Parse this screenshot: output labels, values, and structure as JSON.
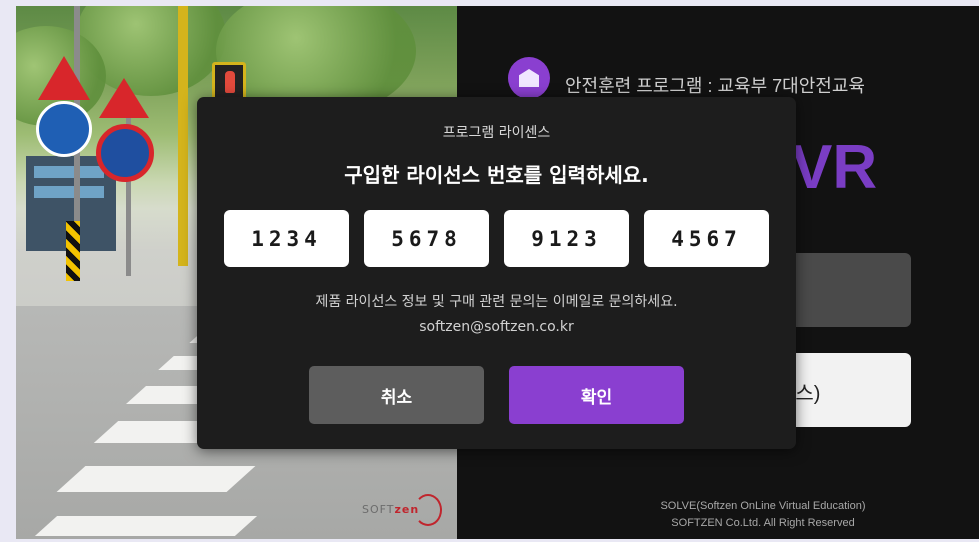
{
  "header": {
    "title": "안전훈련 프로그램 : 교육부 7대안전교육",
    "app_name": "VR"
  },
  "menu": {
    "license_button_label": "센스)"
  },
  "footer": {
    "line1": "SOLVE(Softzen OnLine Virtual Education)",
    "line2": "SOFTZEN Co.Ltd. All Right Reserved"
  },
  "brand": {
    "logo_text_gray": "SOFT",
    "logo_text_red": "zen",
    "accent_color": "#8a3fd0",
    "logo_color": "#c0252d"
  },
  "license_dialog": {
    "caption": "프로그램 라이센스",
    "heading": "구입한 라이선스 번호를 입력하세요.",
    "fields": [
      "1234",
      "5678",
      "9123",
      "4567"
    ],
    "info_line": "제품 라이선스 정보 및  구매 관련 문의는 이메일로 문의하세요.",
    "email": "softzen@softzen.co.kr",
    "cancel_label": "취소",
    "confirm_label": "확인"
  }
}
